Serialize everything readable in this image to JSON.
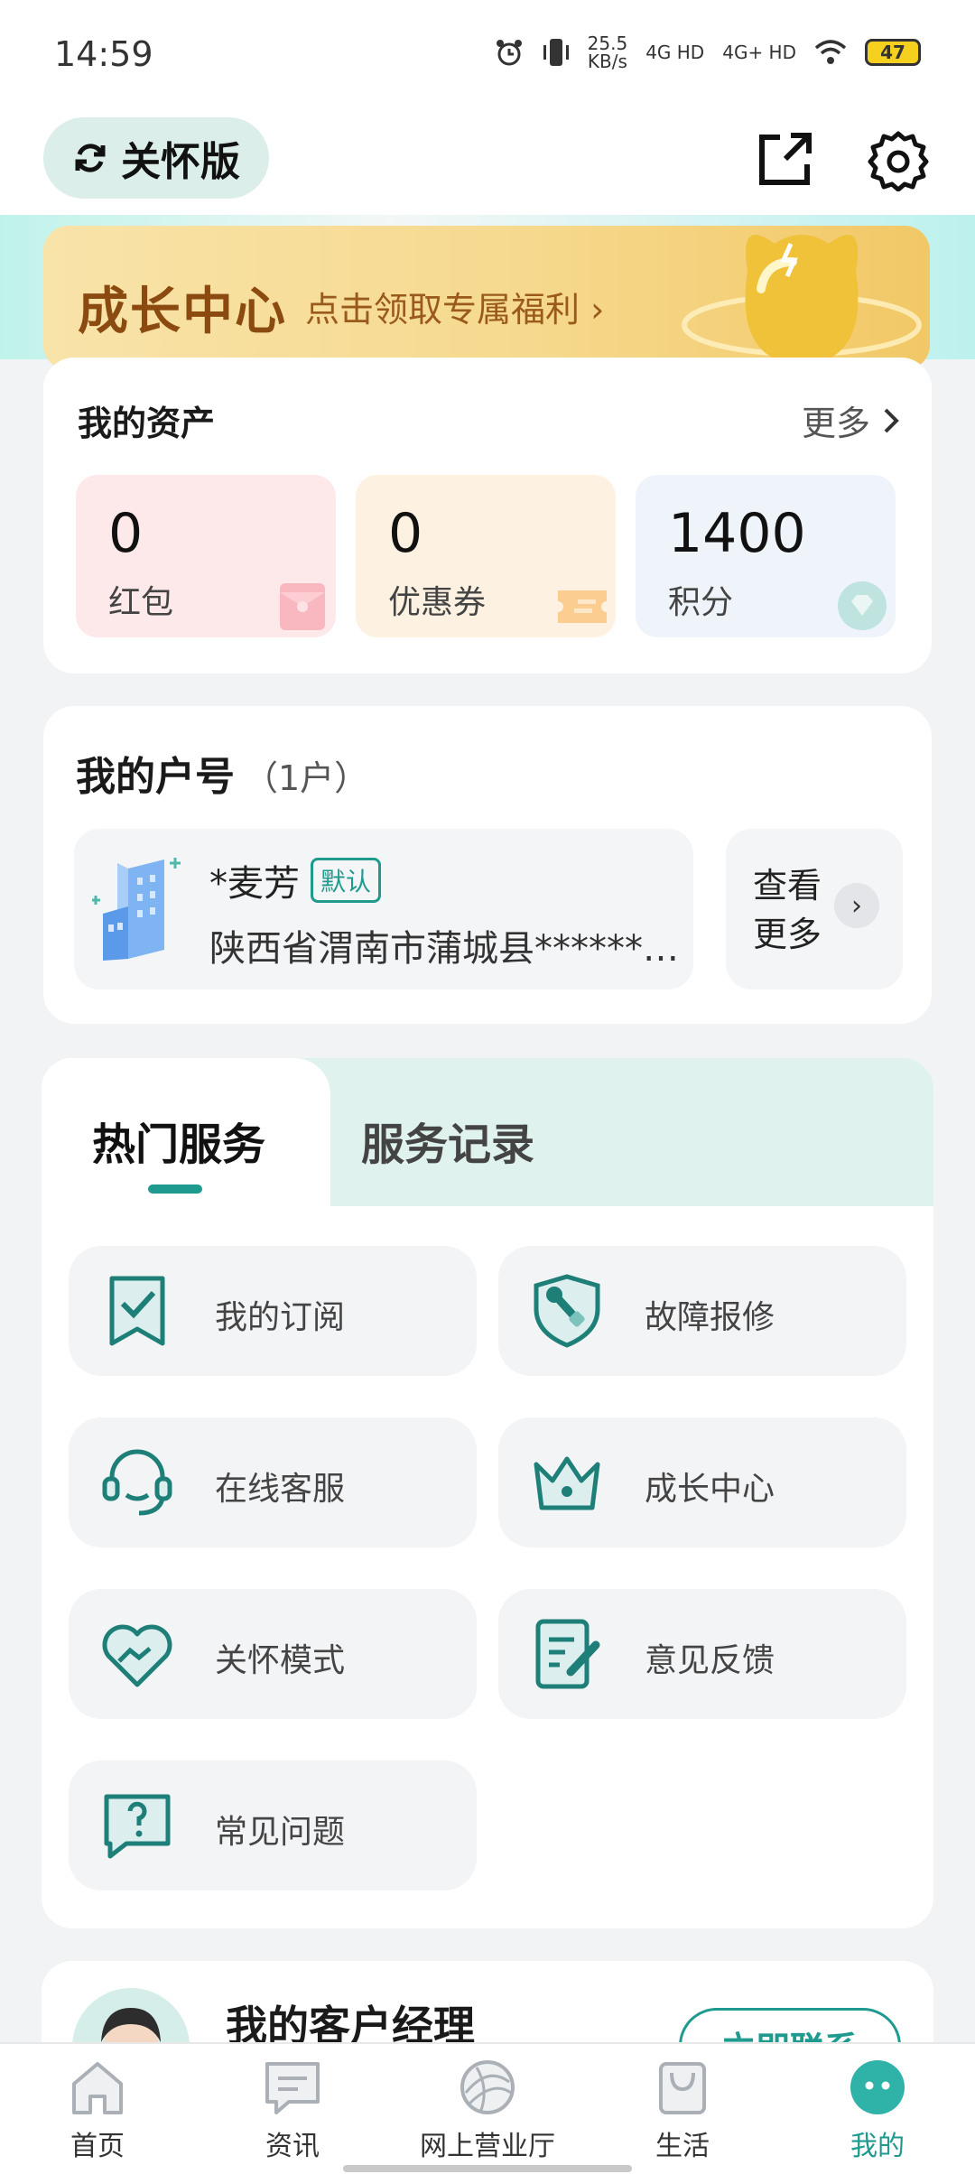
{
  "status_bar": {
    "time": "14:59",
    "net_speed": "25.5",
    "net_unit": "KB/s",
    "sim1": "4G HD",
    "sim2": "4G+ HD",
    "battery": "47"
  },
  "header": {
    "care_mode_label": "关怀版",
    "icons": [
      "refresh-icon",
      "share-icon",
      "gear-icon"
    ]
  },
  "growth_banner": {
    "title": "成长中心",
    "subtitle": "点击领取专属福利 ›"
  },
  "assets": {
    "title": "我的资产",
    "more_label": "更多",
    "items": [
      {
        "value": "0",
        "label": "红包",
        "color": "#fbe8ea"
      },
      {
        "value": "0",
        "label": "优惠券",
        "color": "#fdf3e4"
      },
      {
        "value": "1400",
        "label": "积分",
        "color": "#eef4f8"
      }
    ]
  },
  "account": {
    "title": "我的户号",
    "count": "（1户）",
    "name": "*麦芳",
    "badge": "默认",
    "address": "陕西省渭南市蒲城县******…",
    "more_label": "查看更多"
  },
  "services": {
    "tabs": [
      {
        "label": "热门服务",
        "active": true
      },
      {
        "label": "服务记录",
        "active": false
      }
    ],
    "items": [
      {
        "label": "我的订阅",
        "icon": "subscription-icon"
      },
      {
        "label": "故障报修",
        "icon": "repair-shield-icon"
      },
      {
        "label": "在线客服",
        "icon": "headset-icon"
      },
      {
        "label": "成长中心",
        "icon": "crown-icon"
      },
      {
        "label": "关怀模式",
        "icon": "heart-hands-icon"
      },
      {
        "label": "意见反馈",
        "icon": "feedback-edit-icon"
      },
      {
        "label": "常见问题",
        "icon": "question-bubble-icon"
      }
    ]
  },
  "manager": {
    "title": "我的客户经理",
    "button_label": "立即联系"
  },
  "bottom_nav": {
    "items": [
      {
        "label": "首页",
        "icon": "home-icon",
        "active": false
      },
      {
        "label": "资讯",
        "icon": "news-icon",
        "active": false
      },
      {
        "label": "网上营业厅",
        "icon": "globe-icon",
        "active": false
      },
      {
        "label": "生活",
        "icon": "bag-icon",
        "active": false
      },
      {
        "label": "我的",
        "icon": "profile-face-icon",
        "active": true
      }
    ]
  },
  "colors": {
    "accent": "#1e9a8f",
    "banner_text": "#8b4a10"
  }
}
